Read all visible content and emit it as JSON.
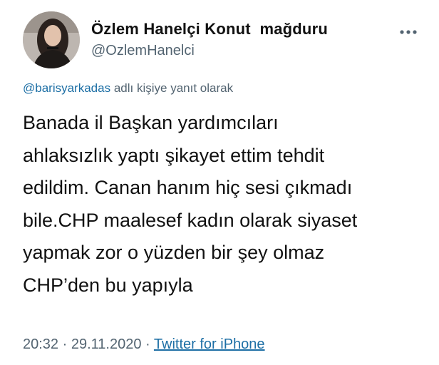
{
  "author": {
    "display_name": "Özlem Hanelçi Konut  mağduru",
    "handle": "@OzlemHanelci"
  },
  "reply_context": {
    "mention": "@barisyarkadas",
    "suffix": "adlı kişiye yanıt olarak"
  },
  "tweet": {
    "lines": [
      "Banada il Başkan yardımcıları",
      "ahlaksızlık yaptı şikayet ettim tehdit",
      "edildim. Canan hanım hiç sesi çıkmadı",
      "bile.CHP maalesef kadın olarak siyaset",
      "yapmak zor o yüzden bir şey olmaz",
      "CHP’den bu yapıyla"
    ]
  },
  "meta": {
    "time": "20:32",
    "separator": "·",
    "date": "29.11.2020",
    "source": "Twitter for iPhone"
  },
  "icons": {
    "more": "more-horizontal-icon"
  },
  "colors": {
    "link": "#1d6fa5",
    "secondary": "#536471",
    "text": "#111111"
  }
}
